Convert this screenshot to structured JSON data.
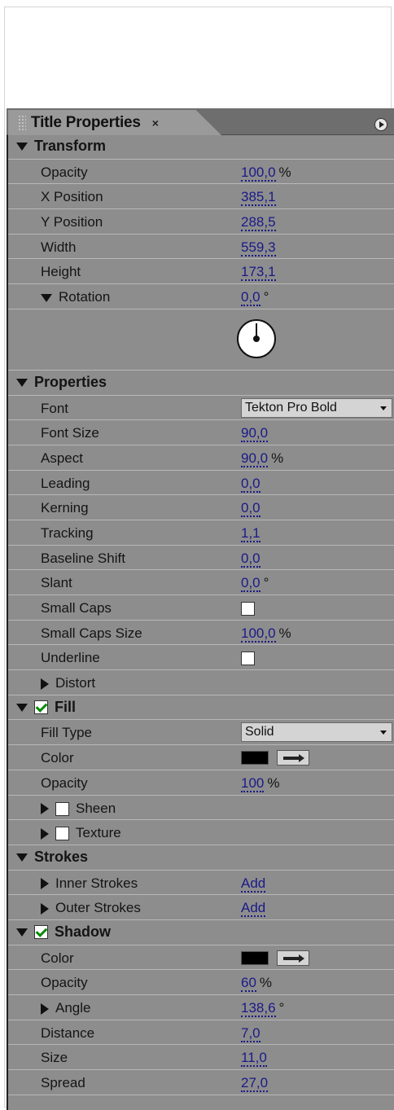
{
  "tab": {
    "title": "Title Properties",
    "close": "×"
  },
  "transform": {
    "header": "Transform",
    "opacity": {
      "label": "Opacity",
      "value": "100,0",
      "unit": "%"
    },
    "x_position": {
      "label": "X Position",
      "value": "385,1"
    },
    "y_position": {
      "label": "Y Position",
      "value": "288,5"
    },
    "width": {
      "label": "Width",
      "value": "559,3"
    },
    "height": {
      "label": "Height",
      "value": "173,1"
    },
    "rotation": {
      "label": "Rotation",
      "value": "0,0",
      "unit": "°"
    }
  },
  "properties": {
    "header": "Properties",
    "font": {
      "label": "Font",
      "value": "Tekton Pro Bold"
    },
    "font_size": {
      "label": "Font Size",
      "value": "90,0"
    },
    "aspect": {
      "label": "Aspect",
      "value": "90,0",
      "unit": "%"
    },
    "leading": {
      "label": "Leading",
      "value": "0,0"
    },
    "kerning": {
      "label": "Kerning",
      "value": "0,0"
    },
    "tracking": {
      "label": "Tracking",
      "value": "1,1"
    },
    "baseline_shift": {
      "label": "Baseline Shift",
      "value": "0,0"
    },
    "slant": {
      "label": "Slant",
      "value": "0,0",
      "unit": "°"
    },
    "small_caps": {
      "label": "Small Caps"
    },
    "small_caps_size": {
      "label": "Small Caps Size",
      "value": "100,0",
      "unit": "%"
    },
    "underline": {
      "label": "Underline"
    },
    "distort": {
      "label": "Distort"
    }
  },
  "fill": {
    "header": "Fill",
    "fill_type": {
      "label": "Fill Type",
      "value": "Solid"
    },
    "color": {
      "label": "Color"
    },
    "opacity": {
      "label": "Opacity",
      "value": "100",
      "unit": "%"
    },
    "sheen": {
      "label": "Sheen"
    },
    "texture": {
      "label": "Texture"
    }
  },
  "strokes": {
    "header": "Strokes",
    "inner": {
      "label": "Inner Strokes",
      "value": "Add"
    },
    "outer": {
      "label": "Outer Strokes",
      "value": "Add"
    }
  },
  "shadow": {
    "header": "Shadow",
    "color": {
      "label": "Color"
    },
    "opacity": {
      "label": "Opacity",
      "value": "60",
      "unit": "%"
    },
    "angle": {
      "label": "Angle",
      "value": "138,6",
      "unit": "°"
    },
    "distance": {
      "label": "Distance",
      "value": "7,0"
    },
    "size": {
      "label": "Size",
      "value": "11,0"
    },
    "spread": {
      "label": "Spread",
      "value": "27,0"
    }
  },
  "colors": {
    "panel": "#8d8d8d",
    "value_link": "#1a1a88",
    "check": "#0a8a0a",
    "swatch": "#000000"
  }
}
